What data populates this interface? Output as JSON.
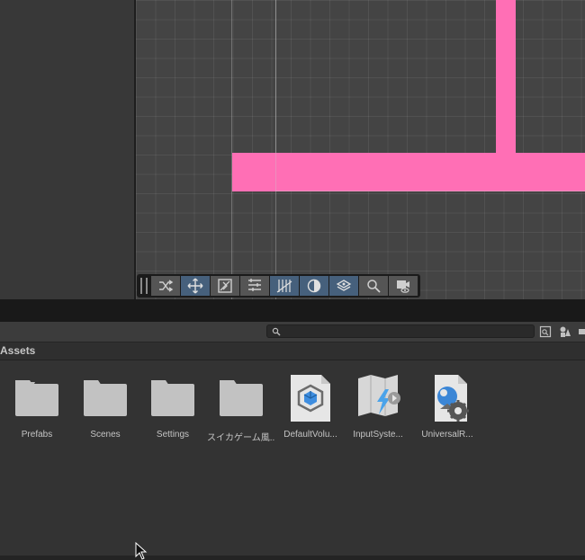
{
  "scene": {
    "colors": {
      "background": "#444444",
      "sprite": "#ff6fb5"
    }
  },
  "toolbar": {
    "tools": [
      {
        "name": "shuffle-icon",
        "active": false
      },
      {
        "name": "move-icon",
        "active": true
      },
      {
        "name": "snap-icon",
        "active": false
      },
      {
        "name": "align-icon",
        "active": false
      },
      {
        "name": "grid-icon",
        "active": true
      },
      {
        "name": "circle-half-icon",
        "active": true
      },
      {
        "name": "layers-icon",
        "active": true
      },
      {
        "name": "search-icon",
        "active": false
      },
      {
        "name": "camera-icon",
        "active": false
      }
    ]
  },
  "project": {
    "search": {
      "value": "",
      "placeholder": ""
    },
    "breadcrumb": "Assets",
    "assets": [
      {
        "label": "Prefabs",
        "icon": "folder-icon"
      },
      {
        "label": "Scenes",
        "icon": "folder-icon"
      },
      {
        "label": "Settings",
        "icon": "folder-icon"
      },
      {
        "label": "スイカゲーム風...",
        "icon": "folder-icon"
      },
      {
        "label": "DefaultVolu...",
        "icon": "volume-profile-icon"
      },
      {
        "label": "InputSyste...",
        "icon": "input-actions-icon"
      },
      {
        "label": "UniversalR...",
        "icon": "render-pipeline-asset-icon"
      }
    ]
  },
  "colors": {
    "accent": "#46607c",
    "panel": "#333333"
  }
}
